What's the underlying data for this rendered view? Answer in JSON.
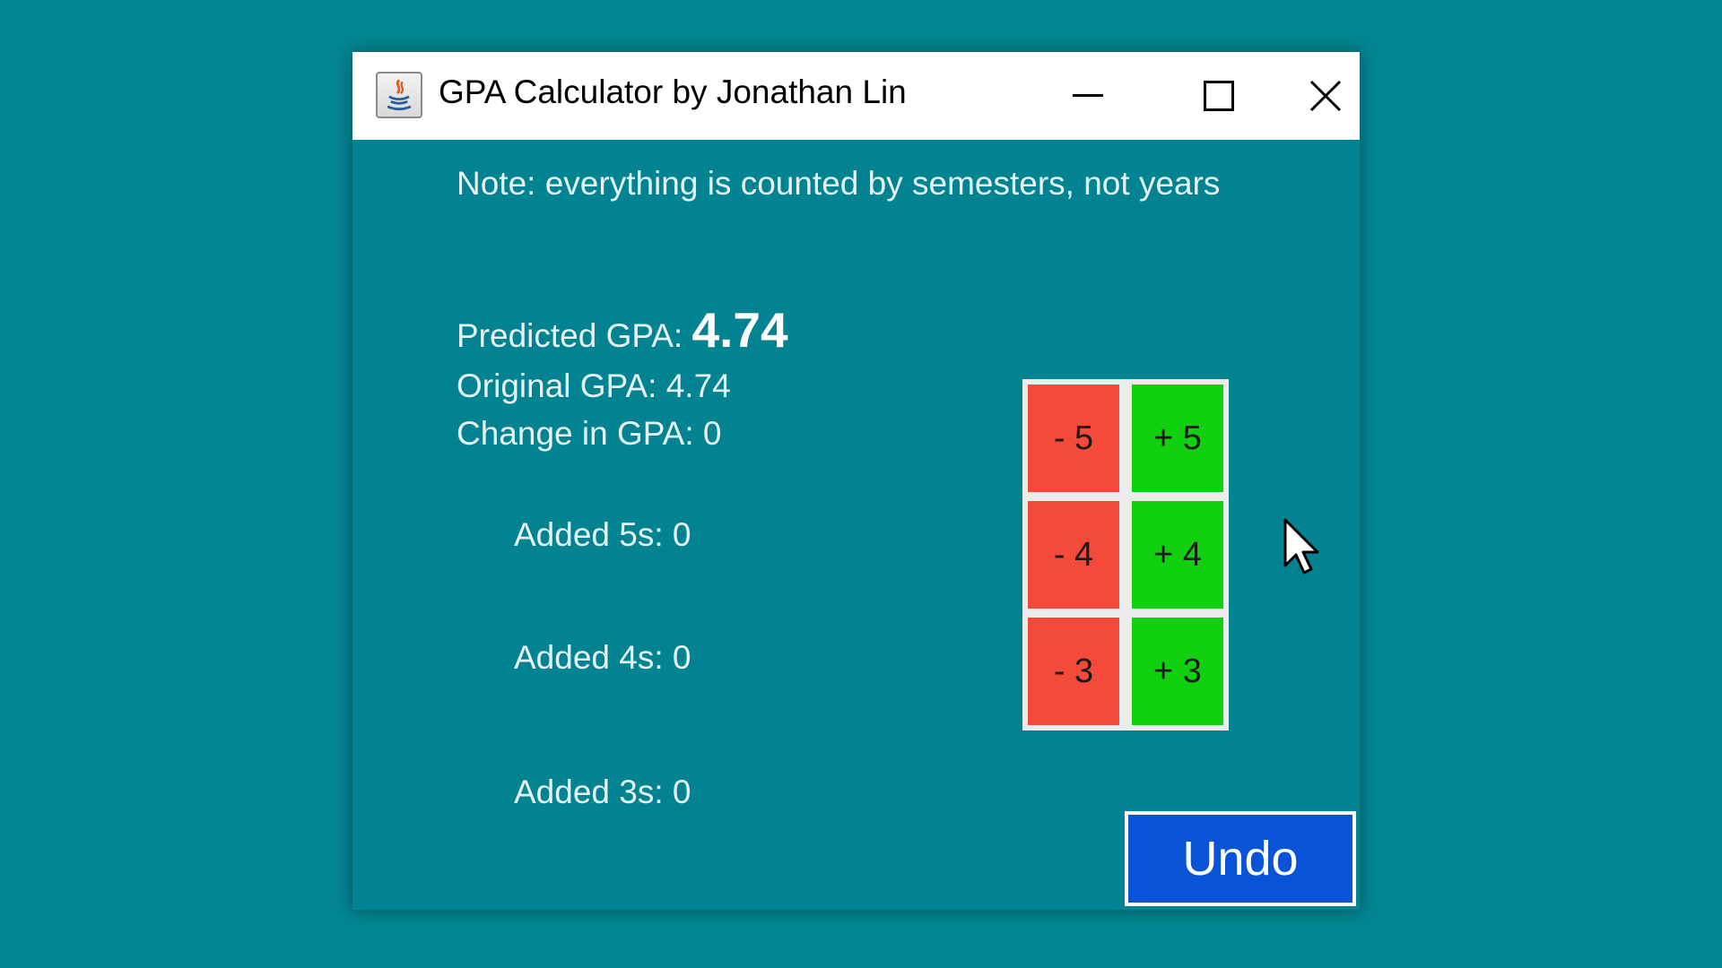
{
  "window": {
    "title": "GPA Calculator by Jonathan Lin",
    "icon": "java-app-icon",
    "controls": [
      "minimize-icon",
      "maximize-icon",
      "close-icon"
    ]
  },
  "note": "Note: everything is counted by semesters, not years",
  "stats": {
    "predicted_label": "Predicted GPA: ",
    "predicted_value": "4.74",
    "original": "Original GPA: 4.74",
    "change": "Change in GPA: 0"
  },
  "added": {
    "fives": "Added 5s: 0",
    "fours": "Added 4s: 0",
    "threes": "Added 3s: 0"
  },
  "buttons": {
    "minus5": "- 5",
    "plus5": "+ 5",
    "minus4": "- 4",
    "plus4": "+ 4",
    "minus3": "- 3",
    "plus3": "+ 3",
    "undo": "Undo"
  },
  "colors": {
    "background": "#038693",
    "minus": "#f44a3a",
    "plus": "#10d010",
    "undo": "#0954d6"
  }
}
